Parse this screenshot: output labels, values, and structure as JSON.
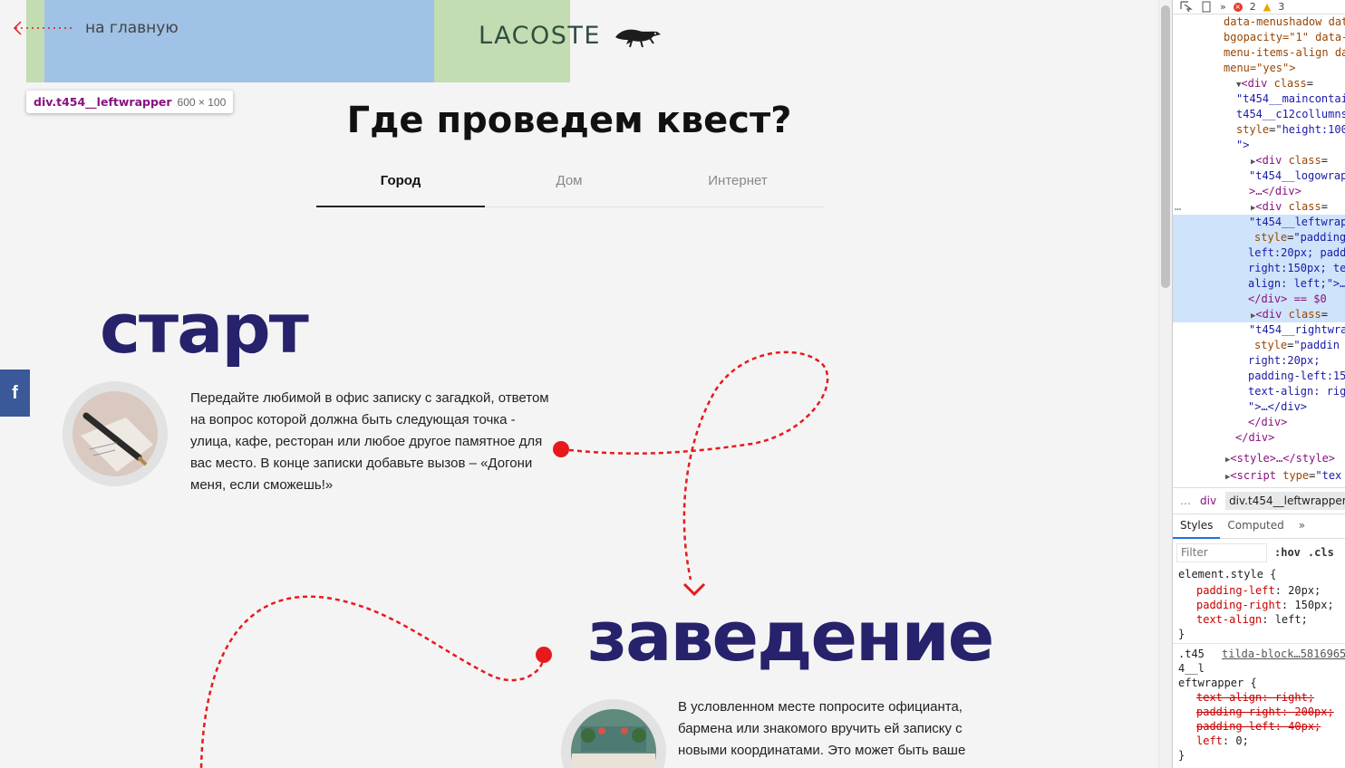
{
  "header": {
    "back_label": "на главную",
    "logo_text": "LACOSTE",
    "logo_icon": "crocodile-icon"
  },
  "inspector_tooltip": {
    "selector": "div.t454__leftwrapper",
    "size": "600 × 100"
  },
  "quest": {
    "title": "Где проведем квест?",
    "tabs": [
      "Город",
      "Дом",
      "Интернет"
    ],
    "active_tab": "Город"
  },
  "steps": [
    {
      "title": "старт",
      "text": "Передайте любимой в офис записку с загадкой, ответом на вопрос которой должна быть следующая точка - улица, кафе, ресторан или любое другое памятное для вас место. В конце записки добавьте вызов – «Догони меня, если сможешь!»"
    },
    {
      "title": "заведение",
      "text": "В условленном месте попросите официанта, бармена или знакомого вручить ей записку с новыми координатами. Это может быть ваше"
    }
  ],
  "share": {
    "facebook_label": "f"
  },
  "colors": {
    "heading": "#27226c",
    "path": "#e8191c",
    "highlight_margin": "#c3dcb2",
    "highlight_content": "#9fc2e6"
  },
  "devtools": {
    "toolbar": {
      "errors": "2",
      "warnings": "3",
      "more": "»"
    },
    "elements": {
      "l0": "data-menushadow data",
      "l1": "bgopacity=\"1\" data-",
      "l2": "menu-items-align da",
      "l3": "menu=\"yes\">",
      "l4_tag": "<div",
      "l4_attr": "class",
      "l5": "\"t454__maincontai",
      "l6": "t454__c12collumns",
      "l7_attr": "style",
      "l7_val": "\"height:100",
      "l8": "\">",
      "l9_tag": "<div",
      "l9_attr": "class",
      "l10": "\"t454__logowrap",
      "l11": ">…</div>",
      "l12_tag": "<div",
      "l12_attr": "class",
      "l13": "\"t454__leftwrap",
      "l14_attr": "style",
      "l14_val": "\"padding",
      "l15": "left:20px; padd",
      "l16": "right:150px; te",
      "l17": "align: left;\">…",
      "l18": "</div> == $0",
      "l19_tag": "<div",
      "l19_attr": "class",
      "l20": "\"t454__rightwra",
      "l21_attr": "style",
      "l21_val": "\"paddin",
      "l22": "right:20px;",
      "l23": "padding-left:15",
      "l24": "text-align: rig",
      "l25": "\">…</div>",
      "l26": "</div>",
      "l27": "</div>",
      "l28": "<style>…</style>",
      "l29_tag": "<script",
      "l29_attr": "type",
      "l29_val": "\"tex",
      "ellipsis": "…"
    },
    "breadcrumbs": [
      "…",
      "div",
      "div.t454__leftwrapper"
    ],
    "panel_tabs": [
      "Styles",
      "Computed"
    ],
    "filter_placeholder": "Filter",
    "pills": [
      ":hov",
      ".cls"
    ],
    "rules": {
      "element_style": "element.style {",
      "pl_prop": "padding-left",
      "pl_val": "20px;",
      "pr_prop": "padding-right",
      "pr_val": "150px;",
      "ta_prop": "text-align",
      "ta_val": "left;",
      "close": "}",
      "sel1": ".t45",
      "sel_link": "tilda-block…5816965",
      "sel2": "4__l",
      "sel3": "eftwrapper {",
      "s_ta": "text-align: right;",
      "s_pr": "padding-right: 200px;",
      "s_pl": "padding-left: 40px;",
      "left_prop": "left",
      "left_val": "0;"
    }
  }
}
